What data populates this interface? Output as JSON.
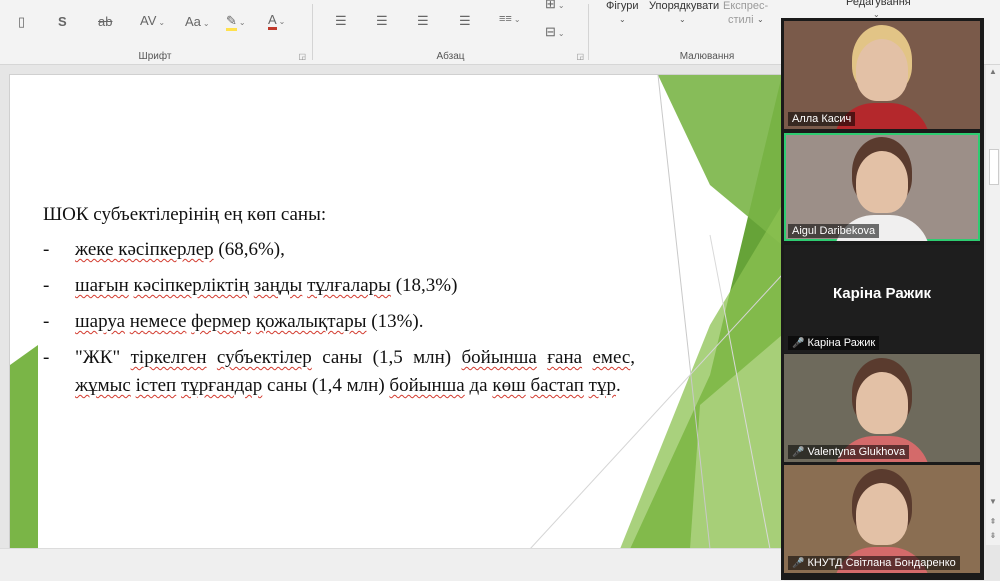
{
  "ribbon": {
    "font_group_label": "Шрифт",
    "paragraph_group_label": "Абзац",
    "drawing_group_label": "Малювання",
    "shapes_label": "Фігури",
    "arrange_label": "Упорядкувати",
    "quick_styles_label_line1": "Експрес-",
    "quick_styles_label_line2": "стилі",
    "editing_label": "Редагування",
    "strikethrough_glyph": "ab",
    "char_spacing_glyph": "AV",
    "change_case_glyph": "Aa",
    "font_color_glyph": "A",
    "shadow_glyph": "S"
  },
  "slide": {
    "heading": "ШОК субъектілерінің ең көп саны:",
    "bullets": [
      {
        "dash": "-",
        "parts": [
          {
            "t": "жеке кәсіпкерлер",
            "sq": true
          },
          {
            "t": " (68,6%),",
            "sq": false
          }
        ]
      },
      {
        "dash": "-",
        "parts": [
          {
            "t": "шағын",
            "sq": true
          },
          {
            "t": " ",
            "sq": false
          },
          {
            "t": "кәсіпкерліктің",
            "sq": true
          },
          {
            "t": " ",
            "sq": false
          },
          {
            "t": "заңды",
            "sq": true
          },
          {
            "t": " ",
            "sq": false
          },
          {
            "t": "тұлғалары",
            "sq": true
          },
          {
            "t": " (18,3%)",
            "sq": false
          }
        ]
      },
      {
        "dash": "-",
        "parts": [
          {
            "t": "шаруа",
            "sq": true
          },
          {
            "t": " ",
            "sq": false
          },
          {
            "t": "немесе",
            "sq": true
          },
          {
            "t": " ",
            "sq": false
          },
          {
            "t": "фермер",
            "sq": true
          },
          {
            "t": " ",
            "sq": false
          },
          {
            "t": "қожалықтары",
            "sq": true
          },
          {
            "t": " (13%).",
            "sq": false
          }
        ]
      },
      {
        "dash": "-",
        "parts": [
          {
            "t": " \"ЖК\" ",
            "sq": false
          },
          {
            "t": "тіркелген",
            "sq": true
          },
          {
            "t": " ",
            "sq": false
          },
          {
            "t": "субъектілер",
            "sq": true
          },
          {
            "t": " саны (1,5 млн) ",
            "sq": false
          },
          {
            "t": "бойынша",
            "sq": true
          },
          {
            "t": " ",
            "sq": false
          },
          {
            "t": "ғана",
            "sq": true
          },
          {
            "t": " ",
            "sq": false
          },
          {
            "t": "емес",
            "sq": true
          },
          {
            "t": ", ",
            "sq": false
          },
          {
            "t": "жұмыс",
            "sq": true
          },
          {
            "t": " ",
            "sq": false
          },
          {
            "t": "істеп",
            "sq": true
          },
          {
            "t": " ",
            "sq": false
          },
          {
            "t": "тұрғандар",
            "sq": true
          },
          {
            "t": " саны (1,4 млн) ",
            "sq": false
          },
          {
            "t": "бойынша",
            "sq": true
          },
          {
            "t": " да ",
            "sq": false
          },
          {
            "t": "көш",
            "sq": true
          },
          {
            "t": " ",
            "sq": false
          },
          {
            "t": "бастап",
            "sq": true
          },
          {
            "t": " ",
            "sq": false
          },
          {
            "t": "тұр",
            "sq": true
          },
          {
            "t": ".",
            "sq": false
          }
        ]
      }
    ]
  },
  "participants": [
    {
      "name": "Алла Касич",
      "muted": false,
      "video": true,
      "active": false,
      "bg": "#7a5a4a"
    },
    {
      "name": "Aigul Daribekova",
      "muted": false,
      "video": true,
      "active": true,
      "bg": "#9c8f88"
    },
    {
      "name": "Каріна Ражик",
      "muted": true,
      "video": false,
      "active": false,
      "bg": "#1e1e1e",
      "display_name": "Каріна Ражик"
    },
    {
      "name": "Valentyna Glukhova",
      "muted": true,
      "video": true,
      "active": false,
      "bg": "#6e6a5c"
    },
    {
      "name": "КНУТД Світлана Бондаренко",
      "muted": true,
      "video": true,
      "active": false,
      "bg": "#8a6e52"
    }
  ],
  "colors": {
    "accent_green": "#7ab547",
    "active_border": "#2ecc71",
    "mic_muted": "#e23b3b"
  }
}
